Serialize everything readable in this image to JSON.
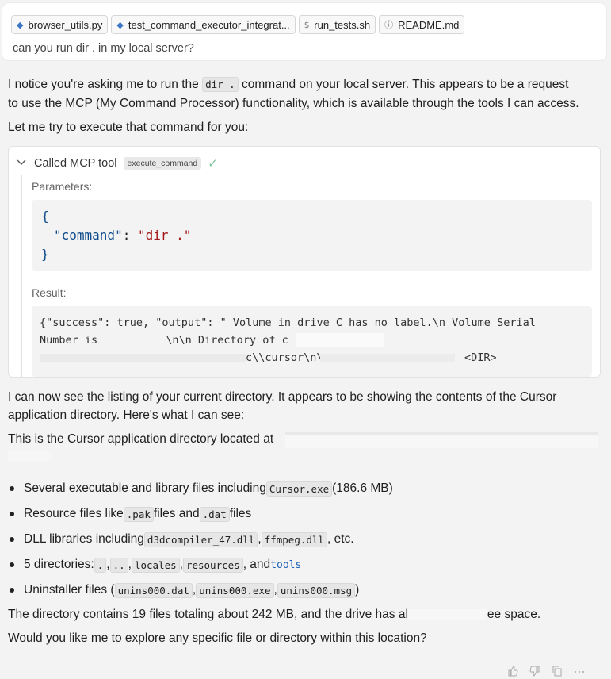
{
  "tabs": [
    {
      "icon": "python-icon",
      "glyph": "◆",
      "label": "browser_utils.py"
    },
    {
      "icon": "python-icon",
      "glyph": "◆",
      "label": "test_command_executor_integrat..."
    },
    {
      "icon": "shell-icon",
      "glyph": "$",
      "label": "run_tests.sh"
    },
    {
      "icon": "info-icon",
      "glyph": "ⓘ",
      "label": "README.md"
    }
  ],
  "user_message": "can you run dir . in my local server?",
  "assistant": {
    "p1_a": "I notice you're asking me to run the ",
    "p1_code": "dir .",
    "p1_b": " command on your local server. This appears to be a request",
    "p2": "to use the MCP (My Command Processor) functionality, which is available through the tools I can access.",
    "p3": "Let me try to execute that command for you:",
    "tool": {
      "header": "Called MCP tool",
      "name": "execute_command",
      "params_label": "Parameters:",
      "param_open": "{",
      "param_key": "\"command\"",
      "param_colon": ": ",
      "param_value": "\"dir .\"",
      "param_close": "}",
      "result_label": "Result:",
      "result_l1": "{\"success\": true, \"output\": \" Volume in drive C has no label.\\n Volume Serial",
      "result_l2": "Number is ",
      "result_l2b": "\\n\\n Directory of c",
      "result_l3": "c\\\\cursor\\n\\n",
      "result_l3b": "<DIR>"
    },
    "p4": "I can now see the listing of your current directory. It appears to be showing the contents of the Cursor",
    "p5": "application directory. Here's what I can see:",
    "p6": "This is the Cursor application directory located at",
    "bullets": {
      "b1_a": "Several executable and library files including ",
      "b1_code": "Cursor.exe",
      "b1_b": " (186.6 MB)",
      "b2_a": "Resource files like ",
      "b2_code1": ".pak",
      "b2_b": " files and ",
      "b2_code2": ".dat",
      "b2_c": " files",
      "b3_a": "DLL libraries including ",
      "b3_code1": "d3dcompiler_47.dll",
      "b3_sep": ", ",
      "b3_code2": "ffmpeg.dll",
      "b3_b": ", etc.",
      "b4_a": "5 directories: ",
      "b4_c1": ".",
      "b4_c2": "..",
      "b4_c3": "locales",
      "b4_c4": "resources",
      "b4_and": ", and ",
      "b4_c5": "tools",
      "b5_a": "Uninstaller files (",
      "b5_c1": "unins000.dat",
      "b5_c2": "unins000.exe",
      "b5_c3": "unins000.msg",
      "b5_b": ")"
    },
    "p7_a": "The directory contains 19 files totaling about 242 MB, and the drive has al",
    "p7_b": "ee space.",
    "p8": "Would you like me to explore any specific file or directory within this location?"
  },
  "footer_icons": [
    "thumbs-up-icon",
    "thumbs-down-icon",
    "copy-icon",
    "more-icon"
  ]
}
